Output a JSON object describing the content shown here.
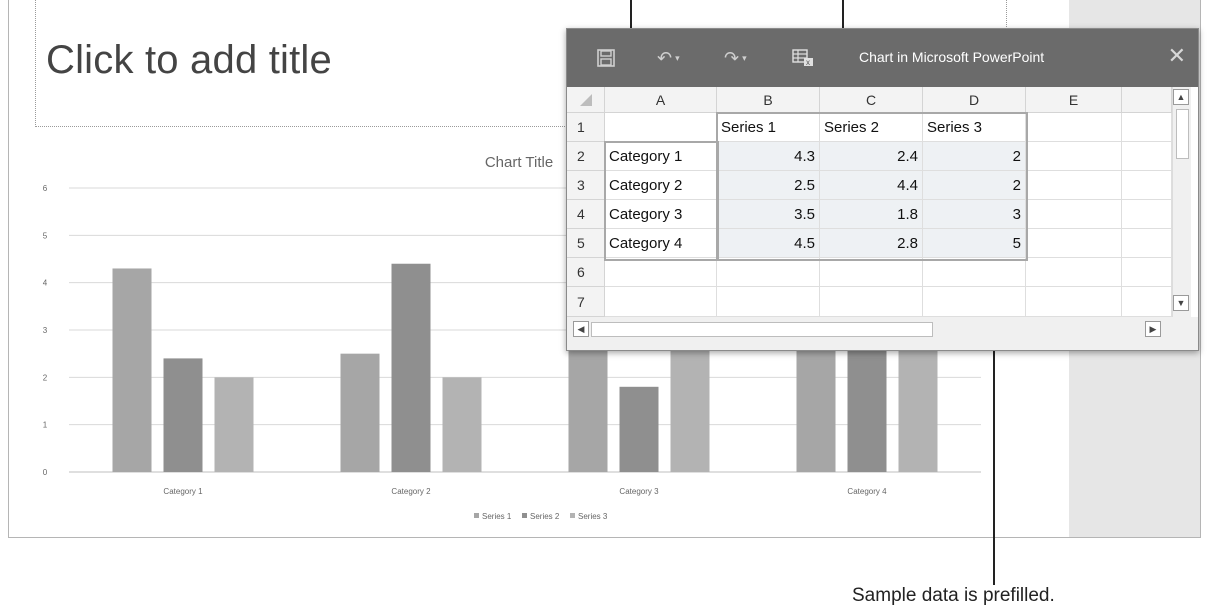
{
  "slide": {
    "title_placeholder": "Click to add title"
  },
  "chart_data": {
    "type": "bar",
    "title": "Chart Title",
    "categories": [
      "Category 1",
      "Category 2",
      "Category 3",
      "Category 4"
    ],
    "series": [
      {
        "name": "Series 1",
        "values": [
          4.3,
          2.5,
          3.5,
          4.5
        ],
        "color": "#a6a6a6"
      },
      {
        "name": "Series 2",
        "values": [
          2.4,
          4.4,
          1.8,
          2.8
        ],
        "color": "#8f8f8f"
      },
      {
        "name": "Series 3",
        "values": [
          2,
          2,
          3,
          5
        ],
        "color": "#b3b3b3"
      }
    ],
    "ylim": [
      0,
      6
    ],
    "yticks": [
      "0",
      "1",
      "2",
      "3",
      "4",
      "5",
      "6"
    ],
    "grid": true,
    "legend": "bottom"
  },
  "dialog": {
    "title": "Chart in Microsoft PowerPoint",
    "toolbar_icons": [
      "save-icon",
      "undo-icon",
      "redo-icon",
      "edit-data-icon"
    ],
    "columns": [
      "A",
      "B",
      "C",
      "D",
      "E"
    ],
    "rows": [
      "1",
      "2",
      "3",
      "4",
      "5",
      "6",
      "7"
    ],
    "cells": [
      [
        "",
        "Series 1",
        "Series 2",
        "Series 3",
        ""
      ],
      [
        "Category 1",
        "4.3",
        "2.4",
        "2",
        ""
      ],
      [
        "Category 2",
        "2.5",
        "4.4",
        "2",
        ""
      ],
      [
        "Category 3",
        "3.5",
        "1.8",
        "3",
        ""
      ],
      [
        "Category 4",
        "4.5",
        "2.8",
        "5",
        ""
      ],
      [
        "",
        "",
        "",
        "",
        ""
      ],
      [
        "",
        "",
        "",
        "",
        ""
      ]
    ]
  },
  "callout": {
    "text": "Sample data is prefilled."
  }
}
